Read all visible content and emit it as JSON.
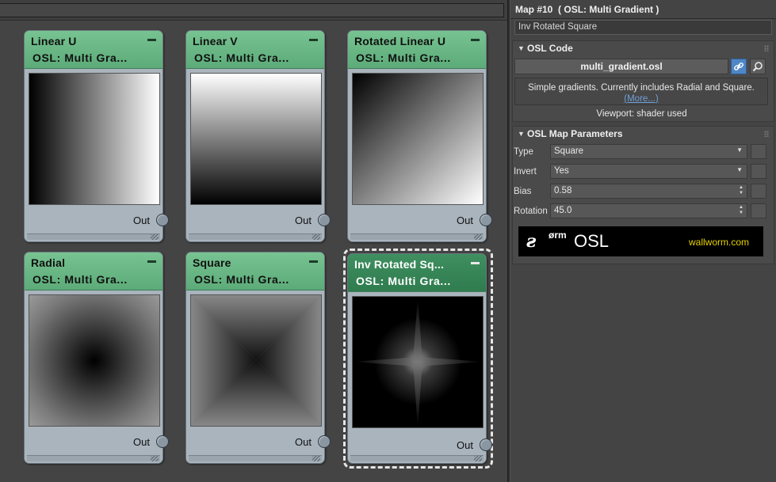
{
  "panel": {
    "title": "Map #10  ( OSL: Multi Gradient )",
    "name_value": "Inv Rotated Square",
    "osl_code": {
      "header": "OSL Code",
      "file_name": "multi_gradient.osl",
      "link_icon": "link-icon",
      "browse_icon": "magnifier-icon",
      "description": "Simple gradients. Currently includes Radial and Square.",
      "more_link": "(More...)",
      "viewport_note": "Viewport: shader used"
    },
    "params": {
      "header": "OSL Map Parameters",
      "rows": [
        {
          "label": "Type",
          "value": "Square",
          "kind": "dropdown"
        },
        {
          "label": "Invert",
          "value": "Yes",
          "kind": "dropdown"
        },
        {
          "label": "Bias",
          "value": "0.58",
          "kind": "spinner"
        },
        {
          "label": "Rotation",
          "value": "45.0",
          "kind": "spinner"
        }
      ]
    },
    "banner": {
      "orm": "ørm",
      "osl": "OSL",
      "url": "wallworm.com"
    }
  },
  "nodes": [
    {
      "title": "Linear U",
      "subtitle": "OSL: Multi Gra...",
      "out": "Out",
      "preview": "linear-u"
    },
    {
      "title": "Linear V",
      "subtitle": "OSL: Multi Gra...",
      "out": "Out",
      "preview": "linear-v"
    },
    {
      "title": "Rotated Linear U",
      "subtitle": "OSL: Multi Gra...",
      "out": "Out",
      "preview": "rotated-linear-u"
    },
    {
      "title": "Radial",
      "subtitle": "OSL: Multi Gra...",
      "out": "Out",
      "preview": "radial"
    },
    {
      "title": "Square",
      "subtitle": "OSL: Multi Gra...",
      "out": "Out",
      "preview": "square"
    },
    {
      "title": "Inv Rotated Sq...",
      "subtitle": "OSL: Multi Gra...",
      "out": "Out",
      "preview": "inv-rotated-square",
      "selected": true
    }
  ]
}
